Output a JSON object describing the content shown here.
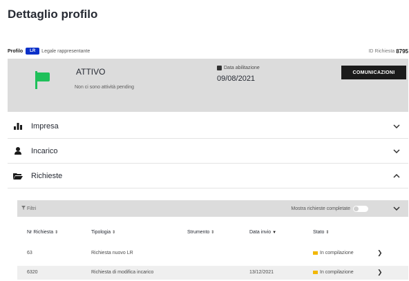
{
  "page": {
    "title": "Dettaglio profilo"
  },
  "profile": {
    "label": "Profilo",
    "badge": "LR",
    "role": "Legale rappresentante",
    "request_label": "ID Richiesta",
    "request_id": "8795"
  },
  "status": {
    "title": "ATTIVO",
    "subtitle": "Non ci sono attività pending",
    "date_label": "Data abilitazione",
    "date_value": "09/08/2021",
    "button": "COMUNICAZIONI",
    "flag_color": "#1fc05a"
  },
  "accordion": [
    {
      "label": "Impresa",
      "icon": "org-chart-icon",
      "expanded": false
    },
    {
      "label": "Incarico",
      "icon": "user-icon",
      "expanded": false
    },
    {
      "label": "Richieste",
      "icon": "folder-open-icon",
      "expanded": true
    }
  ],
  "filters": {
    "label": "Filtri",
    "toggle_label": "Mostra richieste completate"
  },
  "table": {
    "columns": [
      "Nr Richiesta",
      "Tipologia",
      "Strumento",
      "Data invio",
      "Stato"
    ],
    "rows": [
      {
        "nr": "63",
        "tipologia": "Richiesta nuovo LR",
        "strumento": "",
        "data": "",
        "stato": "In compilazione"
      },
      {
        "nr": "6320",
        "tipologia": "Richiesta di modifica incarico",
        "strumento": "",
        "data": "13/12/2021",
        "stato": "In compilazione"
      }
    ]
  },
  "colors": {
    "accent": "#0b30c9",
    "status_pending": "#f2b705"
  }
}
